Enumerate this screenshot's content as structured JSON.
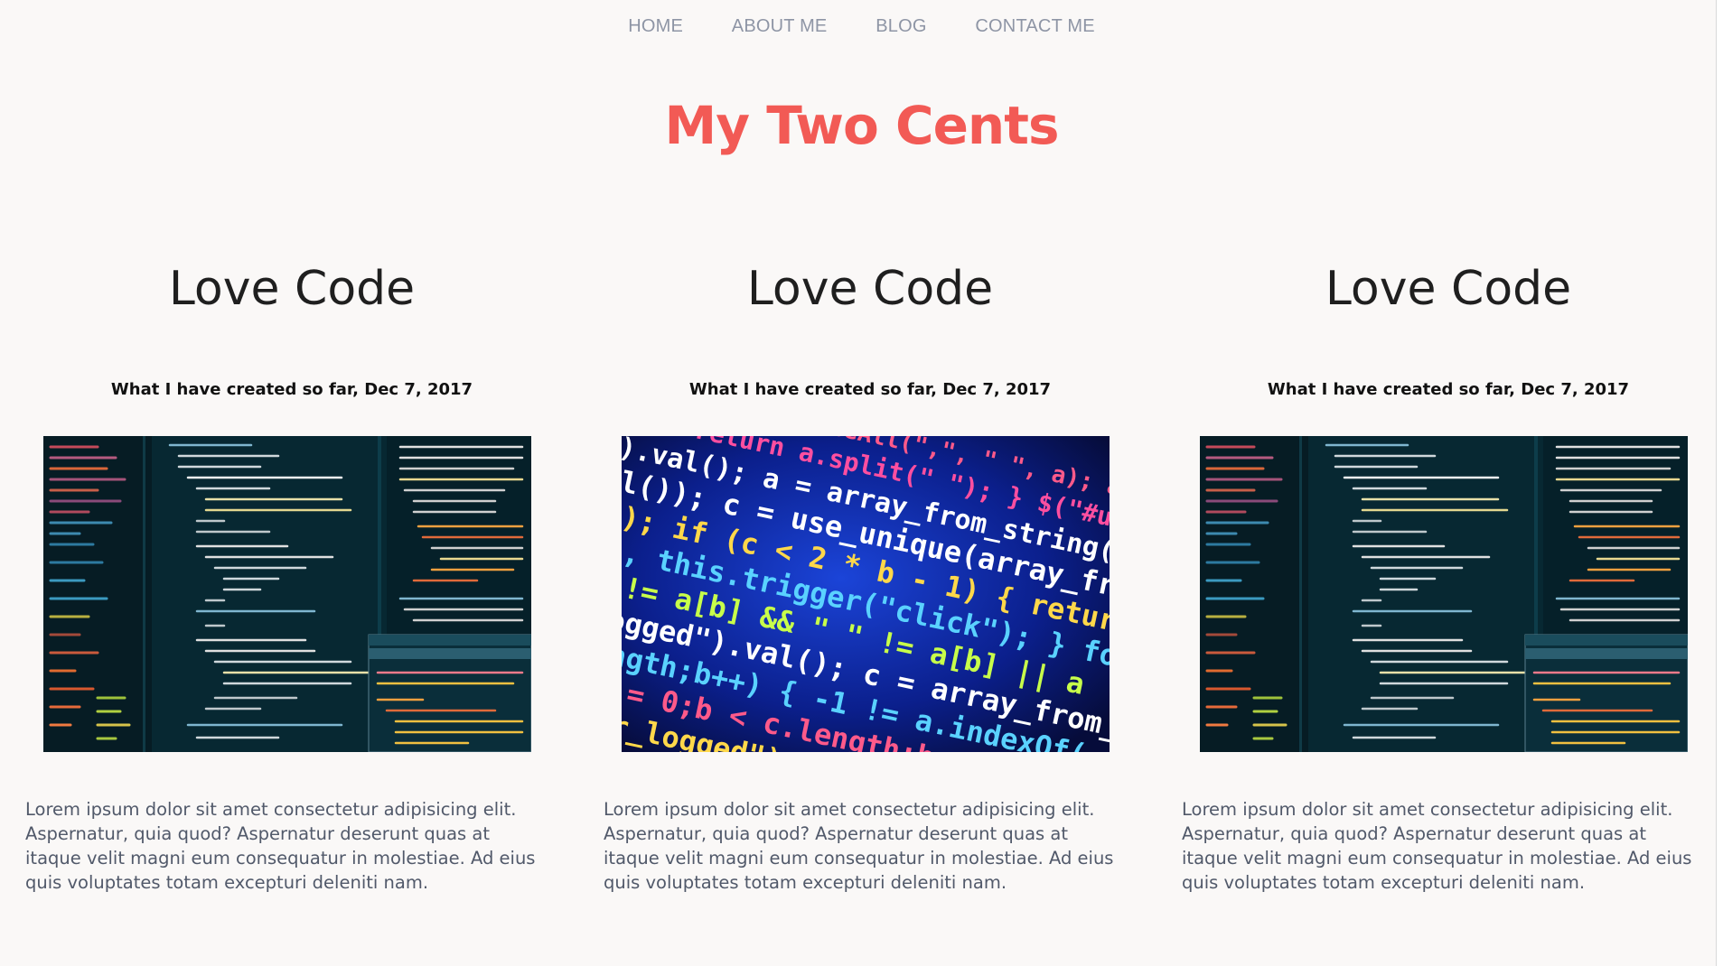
{
  "nav": {
    "items": [
      "HOME",
      "ABOUT ME",
      "BLOG",
      "CONTACT ME"
    ]
  },
  "site": {
    "title": "My Two Cents"
  },
  "posts": [
    {
      "title": "Love Code",
      "meta": "What I have created so far, Dec 7, 2017",
      "image_icon": "code-editor-dark-image",
      "excerpt": "Lorem ipsum dolor sit amet consectetur adipisicing elit. Aspernatur, quia quod? Aspernatur deserunt quas at itaque velit magni eum consequatur in molestiae. Ad eius quis voluptates totam excepturi deleniti nam."
    },
    {
      "title": "Love Code",
      "meta": "What I have created so far, Dec 7, 2017",
      "image_icon": "code-closeup-blue-image",
      "excerpt": "Lorem ipsum dolor sit amet consectetur adipisicing elit. Aspernatur, quia quod? Aspernatur deserunt quas at itaque velit magni eum consequatur in molestiae. Ad eius quis voluptates totam excepturi deleniti nam."
    },
    {
      "title": "Love Code",
      "meta": "What I have created so far, Dec 7, 2017",
      "image_icon": "code-editor-dark-image",
      "excerpt": "Lorem ipsum dolor sit amet consectetur adipisicing elit. Aspernatur, quia quod? Aspernatur deserunt quas at itaque velit magni eum consequatur in molestiae. Ad eius quis voluptates totam excepturi deleniti nam."
    }
  ],
  "colors": {
    "title": "#f25a55",
    "nav": "#8e95a5",
    "excerpt": "#51596a",
    "background": "#faf8f7"
  }
}
